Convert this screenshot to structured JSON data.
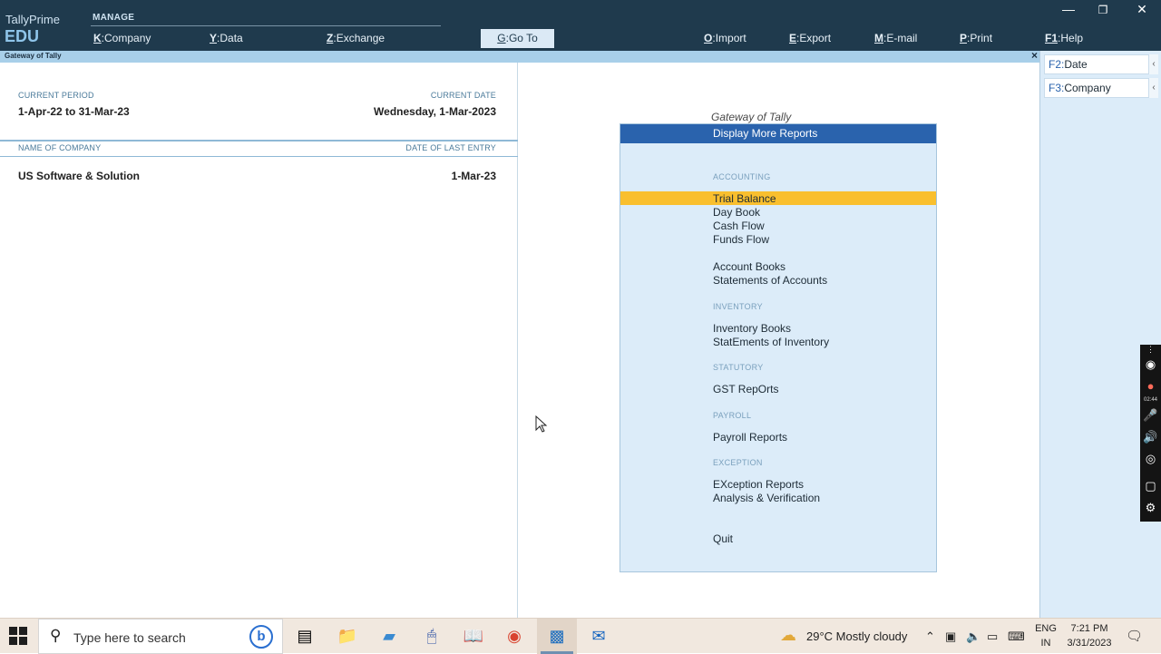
{
  "app": {
    "brand_top": "TallyPrime",
    "brand_bottom": "EDU",
    "section": "MANAGE"
  },
  "topmenu": [
    {
      "key": "K",
      "label": "Company"
    },
    {
      "key": "Y",
      "label": "Data"
    },
    {
      "key": "Z",
      "label": "Exchange"
    },
    {
      "key": "G",
      "label": "Go To"
    },
    {
      "key": "O",
      "label": "Import"
    },
    {
      "key": "E",
      "label": "Export"
    },
    {
      "key": "M",
      "label": "E-mail"
    },
    {
      "key": "P",
      "label": "Print"
    },
    {
      "key": "F1",
      "label": "Help"
    }
  ],
  "window": {
    "title": "Gateway of Tally",
    "close": "×"
  },
  "left": {
    "current_period_label": "CURRENT PERIOD",
    "current_period_value": "1-Apr-22 to 31-Mar-23",
    "current_date_label": "CURRENT DATE",
    "current_date_value": "Wednesday, 1-Mar-2023",
    "company_col_label": "NAME OF COMPANY",
    "last_entry_col_label": "DATE OF LAST ENTRY",
    "company_name": "US Software & Solution",
    "last_entry_date": "1-Mar-23"
  },
  "gateway": {
    "title": "Gateway of Tally",
    "header": "Display More Reports",
    "sections": {
      "accounting": "ACCOUNTING",
      "inventory": "INVENTORY",
      "statutory": "STATUTORY",
      "payroll": "PAYROLL",
      "exception": "EXCEPTION"
    },
    "items": {
      "trial_balance": "Trial Balance",
      "day_book": "Day Book",
      "cash_flow": "Cash Flow",
      "funds_flow": "Funds Flow",
      "account_books": "Account Books",
      "statements_of_accounts": "Statements of Accounts",
      "inventory_books": "Inventory Books",
      "statements_of_inventory": "StatEments of Inventory",
      "gst_reports": "GST RepOrts",
      "payroll_reports": "Payroll Reports",
      "exception_reports": "EXception Reports",
      "analysis_verification": "Analysis & Verification",
      "quit": "Quit"
    }
  },
  "side": {
    "f2_key": "F2:",
    "f2_label": "Date",
    "f3_key": "F3:",
    "f3_label": "Company",
    "chevron": "‹"
  },
  "recorder": {
    "timer": "02:44"
  },
  "taskbar": {
    "search_placeholder": "Type here to search",
    "bing": "b",
    "weather": "29°C  Mostly cloudy",
    "lang_top": "ENG",
    "lang_bottom": "IN",
    "time": "7:21 PM",
    "date": "3/31/2023"
  }
}
